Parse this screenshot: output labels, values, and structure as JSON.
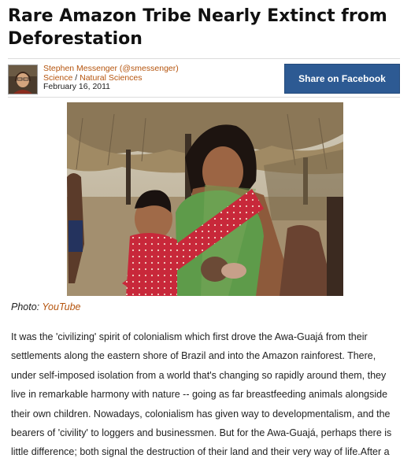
{
  "article": {
    "title": "Rare Amazon Tribe Nearly Extinct from Deforestation",
    "author": "Stephen Messenger (@smessenger)",
    "category": "Science",
    "category_separator": "/",
    "subcategory": "Natural Sciences",
    "date": "February 16, 2011",
    "share_button": "Share on Facebook",
    "photo_caption_prefix": "Photo:",
    "photo_credit": "YouTube",
    "body": "It was the 'civilizing' spirit of colonialism which first drove the Awa-Guajá from their settlements along the eastern shore of Brazil and into the Amazon rainforest. There, under self-imposed isolation from a world that's changing so rapidly around them, they live in remarkable harmony with nature -- going as far breastfeeding animals alongside their own children. Nowadays, colonialism has given way to developmentalism, and the bearers of 'civility' to loggers and businessmen. But for the Awa-Guajá, perhaps there is little difference; both signal the destruction of their land and their very way of life.After a"
  },
  "colors": {
    "link": "#b5540d",
    "facebook_button": "#2d5a93"
  }
}
